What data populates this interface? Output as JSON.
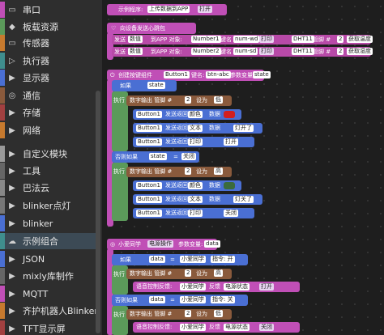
{
  "sidebar": {
    "items": [
      {
        "label": "串口",
        "color": "#c04fb6",
        "icon": "serial-icon"
      },
      {
        "label": "板载资源",
        "color": "#5b9a5a",
        "icon": "chip-icon"
      },
      {
        "label": "传感器",
        "color": "#c77a2e",
        "icon": "sensor-icon"
      },
      {
        "label": "执行器",
        "color": "#3f8e8e",
        "icon": "actuator-icon"
      },
      {
        "label": "显示器",
        "color": "#4a6fd3",
        "icon": "display-icon"
      },
      {
        "label": "通信",
        "color": "#8a5a3c",
        "icon": "wifi-icon"
      },
      {
        "label": "存储",
        "color": "#a24040",
        "icon": "storage-icon"
      },
      {
        "label": "网络",
        "color": "#c77a2e",
        "icon": "network-icon"
      },
      {
        "label": "自定义模块",
        "color": "#999999",
        "icon": "module-icon"
      },
      {
        "label": "工具",
        "color": "#666666",
        "icon": "tool-icon"
      },
      {
        "label": "巴法云",
        "color": "#888888",
        "icon": "cloud-icon"
      },
      {
        "label": "blinker点灯",
        "color": "#777777",
        "icon": "light-icon"
      },
      {
        "label": "blinker",
        "color": "#4a6fd3",
        "icon": "blinker-icon"
      },
      {
        "label": "示例组合",
        "color": "#3f8e8e",
        "icon": "combo-icon"
      },
      {
        "label": "JSON",
        "color": "#4a6fd3",
        "icon": "json-icon"
      },
      {
        "label": "mixly库制作",
        "color": "#666666",
        "icon": "lib-icon"
      },
      {
        "label": "MQTT",
        "color": "#c04fb6",
        "icon": "mqtt-icon"
      },
      {
        "label": "齐护机器人Blinker",
        "color": "#c77a2e",
        "icon": "robot-icon"
      },
      {
        "label": "TFT显示屏",
        "color": "#a24040",
        "icon": "tft-icon"
      }
    ]
  },
  "ws": {
    "b1": {
      "a": "示例程序:",
      "b": "上传数据到APP",
      "c": "打开"
    },
    "b2": {
      "a": "向设备发送心跳包"
    },
    "b3": {
      "a": "发送",
      "b": "数值",
      "c": "到APP 对象:",
      "d": "Number1",
      "e": "键名",
      "f": "num-wd",
      "g": "打印",
      "h": "DHT11",
      "i": "管脚 #",
      "j": "2",
      "k": "获取温度"
    },
    "b4": {
      "a": "发送",
      "b": "数值",
      "c": "到APP 对象:",
      "d": "Number2",
      "e": "键名",
      "f": "num-sd",
      "g": "打印",
      "h": "DHT11",
      "i": "管脚 #",
      "j": "2",
      "k": "获取湿度"
    },
    "b5": {
      "a": "创建按键组件",
      "b": "Button1",
      "c": "键名:",
      "d": "btn-abc",
      "e": "参数变量",
      "f": "state"
    },
    "if1": {
      "a": "如果",
      "b": "state",
      "c": "=",
      "d": "tap"
    },
    "ex": "执行",
    "dw": {
      "a": "数字输出 管脚 #",
      "b": "2",
      "c": "设为",
      "d": "低",
      "e": "高"
    },
    "btn": {
      "a": "Button1",
      "b": "发送返回",
      "c": "颜色",
      "d": "数据",
      "e": "文本",
      "f": "灯开了",
      "g": "打印",
      "h": "打开",
      "i": "灯关了",
      "j": "关闭"
    },
    "elif": {
      "a": "否则如果",
      "b": "state",
      "c": "=",
      "d": "关闭"
    },
    "b6": {
      "a": "小爱同学",
      "b": "电源操作",
      "c": "参数变量:",
      "d": "data"
    },
    "if2": {
      "a": "如果",
      "b": "data",
      "c": "=",
      "d": "小爱同学",
      "e": "指令: 开"
    },
    "voice": {
      "a": "语音控制反馈:",
      "b": "小爱同学",
      "c": "反馈",
      "d": "电源状态",
      "e": "打开"
    },
    "elif2": {
      "a": "否则如果",
      "b": "data",
      "c": "=",
      "d": "小爱同学",
      "e": "指令: 关"
    },
    "voice2": {
      "a": "语音控制反馈:",
      "b": "小爱同学",
      "c": "反馈",
      "d": "电源状态",
      "e": "关闭"
    }
  }
}
